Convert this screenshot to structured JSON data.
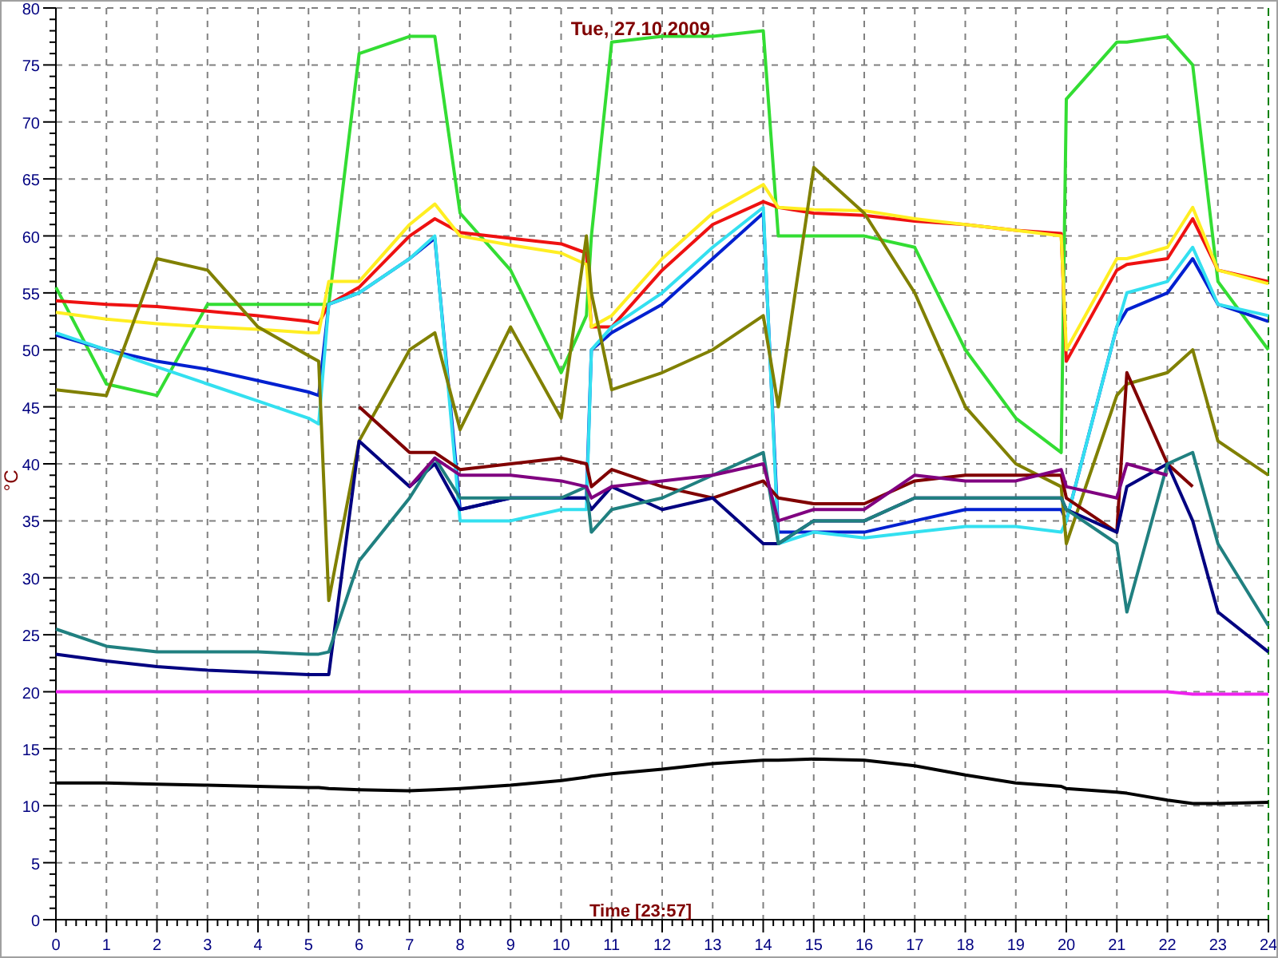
{
  "chart_data": {
    "type": "line",
    "title": "Tue, 27.10.2009",
    "xlabel": "Time [23:57]",
    "ylabel": "°C",
    "x": [
      0,
      1,
      2,
      3,
      4,
      5,
      5.2,
      5.4,
      6,
      7,
      7.5,
      8,
      9,
      10,
      10.5,
      10.6,
      11,
      12,
      13,
      14,
      14.3,
      15,
      16,
      17,
      18,
      19,
      19.9,
      20,
      21,
      21.2,
      22,
      22.5,
      23,
      24
    ],
    "xlim": [
      0,
      24
    ],
    "ylim": [
      0,
      80
    ],
    "grid": true,
    "xticks": [
      0,
      1,
      2,
      3,
      4,
      5,
      6,
      7,
      8,
      9,
      10,
      11,
      12,
      13,
      14,
      15,
      16,
      17,
      18,
      19,
      20,
      21,
      22,
      23,
      24
    ],
    "yticks": [
      0,
      5,
      10,
      15,
      20,
      25,
      30,
      35,
      40,
      45,
      50,
      55,
      60,
      65,
      70,
      75,
      80
    ],
    "series": [
      {
        "color": "#33dd33",
        "values": [
          55.5,
          47,
          46,
          54,
          54,
          54,
          54,
          54,
          76,
          77.5,
          77.5,
          62,
          57,
          48,
          53,
          60,
          77,
          77.5,
          77.5,
          78,
          60,
          60,
          60,
          59,
          50,
          44,
          41,
          72,
          77,
          77,
          77.5,
          75,
          56,
          50
        ]
      },
      {
        "color": "#ee1111",
        "values": [
          54.3,
          54,
          53.8,
          53.4,
          53,
          52.5,
          52.3,
          54,
          55.5,
          60,
          61.5,
          60.3,
          59.8,
          59.3,
          58.5,
          52,
          52,
          57,
          61,
          63,
          62.5,
          62,
          61.8,
          61.3,
          61,
          60.5,
          60.2,
          49,
          57,
          57.5,
          58,
          61.5,
          57,
          56
        ]
      },
      {
        "color": "#ffee22",
        "values": [
          53.3,
          52.7,
          52.3,
          52,
          51.8,
          51.5,
          51.5,
          56,
          56,
          61,
          62.8,
          60,
          59.2,
          58.5,
          57.5,
          52,
          53,
          58,
          62,
          64.5,
          62.5,
          62.3,
          62.2,
          61.5,
          61,
          60.5,
          60,
          50,
          58,
          58,
          59,
          62.5,
          57,
          55.8
        ]
      },
      {
        "color": "#0020d0",
        "values": [
          51.3,
          50,
          49,
          48.3,
          47.3,
          46.3,
          46,
          54,
          55,
          58,
          59.8,
          36,
          37,
          37,
          37,
          50,
          51.5,
          54,
          58,
          62,
          34,
          34,
          34,
          35,
          36,
          36,
          36,
          35,
          52,
          53.5,
          55,
          58,
          54,
          52.5
        ]
      },
      {
        "color": "#33e0f0",
        "values": [
          51.5,
          50,
          48.5,
          47,
          45.5,
          44,
          43.5,
          54,
          55,
          58,
          60,
          35,
          35,
          36,
          36,
          50,
          52,
          55,
          59,
          62.5,
          33,
          34,
          33.5,
          34,
          34.5,
          34.5,
          34,
          35,
          52,
          55,
          56,
          59,
          54,
          53
        ]
      },
      {
        "color": "#808000",
        "values": [
          46.5,
          46,
          58,
          57,
          52,
          49.5,
          49,
          28,
          42,
          50,
          51.5,
          43,
          52,
          44,
          60,
          55,
          46.5,
          48,
          50,
          53,
          45,
          66,
          62,
          55,
          45,
          40,
          38,
          33,
          46,
          47,
          48,
          50,
          42,
          39
        ]
      },
      {
        "color": "#800000",
        "values": [
          null,
          null,
          null,
          null,
          null,
          null,
          null,
          null,
          45,
          41,
          41,
          39.5,
          40,
          40.5,
          40,
          38,
          39.5,
          38,
          37,
          38.5,
          37,
          36.5,
          36.5,
          38.5,
          39,
          39,
          39,
          37,
          34,
          48,
          40,
          38,
          null,
          null
        ]
      },
      {
        "color": "#000080",
        "values": [
          23.3,
          22.7,
          22.2,
          21.9,
          21.7,
          21.5,
          21.5,
          21.5,
          42,
          38,
          40,
          36,
          37,
          37,
          37,
          36,
          38,
          36,
          37,
          33,
          33,
          35,
          35,
          37,
          37,
          37,
          37,
          36,
          34,
          38,
          40,
          35,
          27,
          23.5
        ]
      },
      {
        "color": "#208080",
        "values": [
          25.5,
          24,
          23.5,
          23.5,
          23.5,
          23.3,
          23.3,
          23.5,
          31.5,
          37,
          40.5,
          37,
          37,
          37,
          38,
          34,
          36,
          37,
          39,
          41,
          33,
          35,
          35,
          37,
          37,
          37,
          37,
          36,
          33,
          27,
          40,
          41,
          33,
          25.8
        ]
      },
      {
        "color": "#800080",
        "values": [
          null,
          null,
          null,
          null,
          null,
          null,
          null,
          null,
          null,
          38,
          40.5,
          39,
          39,
          38.5,
          38,
          37,
          38,
          38.5,
          39,
          40,
          35,
          36,
          36,
          39,
          38.5,
          38.5,
          39.5,
          38,
          37,
          40,
          39,
          null,
          null,
          null
        ]
      },
      {
        "color": "#ee22ee",
        "values": [
          20,
          20,
          20,
          20,
          20,
          20,
          20,
          20,
          20,
          20,
          20,
          20,
          20,
          20,
          20,
          20,
          20,
          20,
          20,
          20,
          20,
          20,
          20,
          20,
          20,
          20,
          20,
          20,
          20,
          20,
          20,
          19.8,
          19.8,
          19.8
        ]
      },
      {
        "color": "#000000",
        "values": [
          12,
          12,
          11.9,
          11.8,
          11.7,
          11.6,
          11.6,
          11.5,
          11.4,
          11.3,
          11.4,
          11.5,
          11.8,
          12.2,
          12.5,
          12.6,
          12.8,
          13.2,
          13.7,
          14,
          14,
          14.1,
          14,
          13.5,
          12.7,
          12,
          11.7,
          11.5,
          11.2,
          11.1,
          10.5,
          10.2,
          10.2,
          10.3
        ]
      }
    ]
  }
}
